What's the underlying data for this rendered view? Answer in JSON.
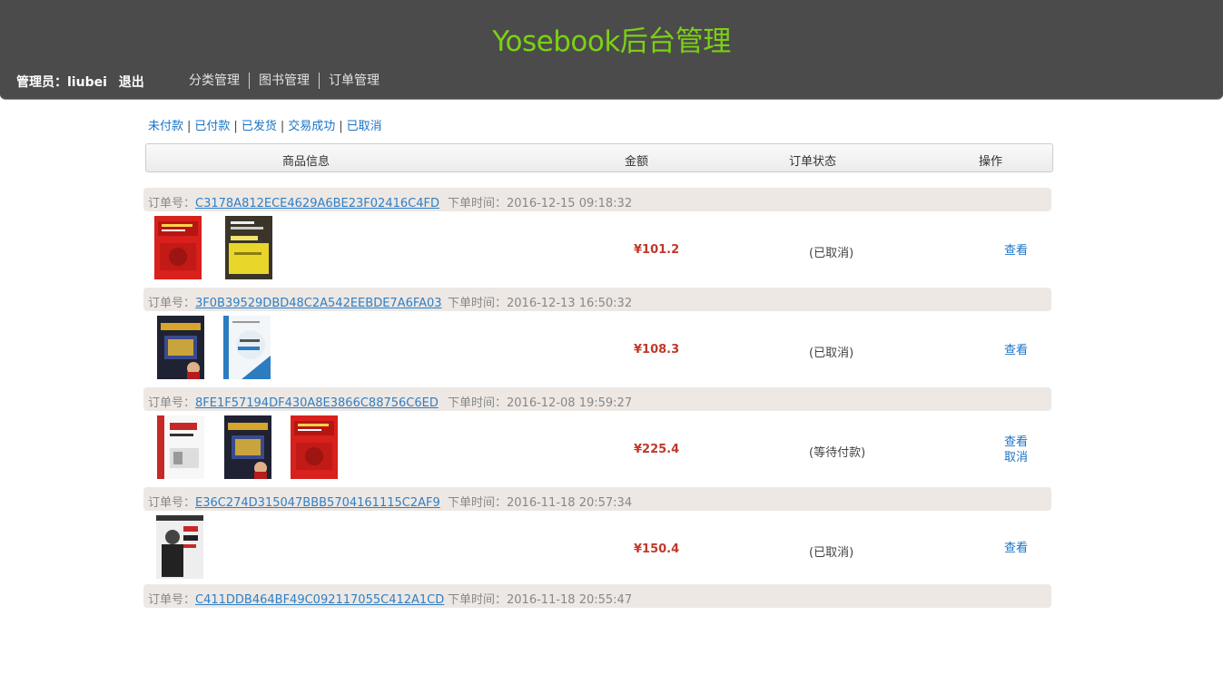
{
  "header": {
    "title": "Yosebook后台管理",
    "admin_prefix": "管理员：liubei",
    "logout": "退出",
    "nav": [
      "分类管理",
      "图书管理",
      "订单管理"
    ]
  },
  "filters": [
    "未付款",
    "已付款",
    "已发货",
    "交易成功",
    "已取消"
  ],
  "table_headers": {
    "product": "商品信息",
    "amount": "金额",
    "status": "订单状态",
    "actions": "操作"
  },
  "labels": {
    "order_no": "订单号：",
    "order_time": "下单时间："
  },
  "orders": [
    {
      "id": "C3178A812ECE4629A6BE23F02416C4FD",
      "time": "2016-12-15 09:18:32",
      "books": [
        "red-java-book-cover",
        "yellow-html-css-book-cover"
      ],
      "amount": "¥101.2",
      "status": "(已取消)",
      "actions": [
        "查看"
      ]
    },
    {
      "id": "3F0B39529DBD48C2A542EEBDE7A6FA03",
      "time": "2016-12-13 16:50:32",
      "books": [
        "thinking-in-java-book-cover",
        "jquery-book-cover"
      ],
      "amount": "¥108.3",
      "status": "(已取消)",
      "actions": [
        "查看"
      ]
    },
    {
      "id": "8FE1F57194DF430A8E3866C88756C6ED",
      "time": "2016-12-08 19:59:27",
      "books": [
        "java-beginner-book-cover",
        "thinking-in-java-book-cover",
        "red-java-book-cover"
      ],
      "amount": "¥225.4",
      "status": "(等待付款)",
      "actions": [
        "查看",
        "取消"
      ]
    },
    {
      "id": "E36C274D315047BBB5704161115C2AF9",
      "time": "2016-11-18 20:57:34",
      "books": [
        "crazy-java-book-cover"
      ],
      "amount": "¥150.4",
      "status": "(已取消)",
      "actions": [
        "查看"
      ]
    },
    {
      "id": "C411DDB464BF49C092117055C412A1CD",
      "time": "2016-11-18 20:55:47",
      "books": [],
      "amount": "",
      "status": "",
      "actions": []
    }
  ]
}
